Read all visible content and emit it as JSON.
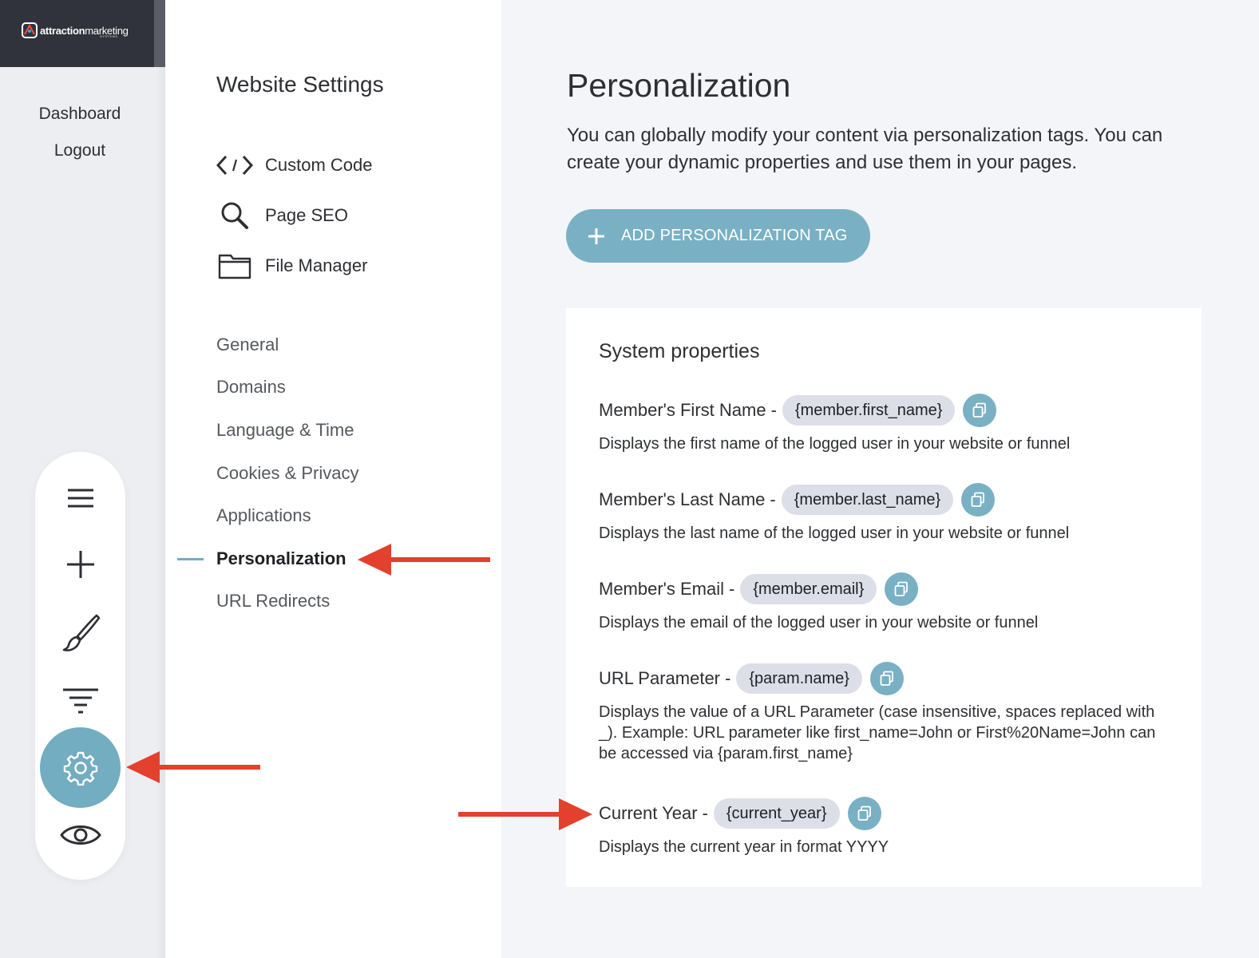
{
  "logo": {
    "brand_bold": "attraction",
    "brand_light": "marketing",
    "sub": "SYSTEMS"
  },
  "rail": {
    "dashboard_label": "Dashboard",
    "logout_label": "Logout",
    "tools": [
      "menu-icon",
      "plus-icon",
      "brush-icon",
      "filter-icon",
      "gear-icon",
      "eye-icon"
    ]
  },
  "settings_nav": {
    "title": "Website Settings",
    "icon_items": [
      {
        "label": "Custom Code",
        "icon": "code-icon"
      },
      {
        "label": "Page SEO",
        "icon": "search-icon"
      },
      {
        "label": "File Manager",
        "icon": "folder-icon"
      }
    ],
    "items": [
      "General",
      "Domains",
      "Language & Time",
      "Cookies & Privacy",
      "Applications",
      "Personalization",
      "URL Redirects"
    ],
    "active": "Personalization"
  },
  "main": {
    "title": "Personalization",
    "description": "You can globally modify your content via personalization tags. You can create your dynamic properties and use them in your pages.",
    "add_button": "ADD PERSONALIZATION TAG",
    "card": {
      "title": "System properties",
      "properties": [
        {
          "name": "Member's First Name",
          "tag": "{member.first_name}",
          "description": "Displays the first name of the logged user in your website or funnel"
        },
        {
          "name": "Member's Last Name",
          "tag": "{member.last_name}",
          "description": "Displays the last name of the logged user in your website or funnel"
        },
        {
          "name": "Member's Email",
          "tag": "{member.email}",
          "description": "Displays the email of the logged user in your website or funnel"
        },
        {
          "name": "URL Parameter",
          "tag": "{param.name}",
          "description": "Displays the value of a URL Parameter (case insensitive, spaces replaced with _). Example: URL parameter like first_name=John or First%20Name=John can be accessed via {param.first_name}"
        },
        {
          "name": "Current Year",
          "tag": "{current_year}",
          "description": "Displays the current year in format YYYY"
        }
      ]
    }
  },
  "colors": {
    "accent": "#79b0c4",
    "annotation_arrow": "#e3402d",
    "tag_bg": "#dcdfe8"
  }
}
